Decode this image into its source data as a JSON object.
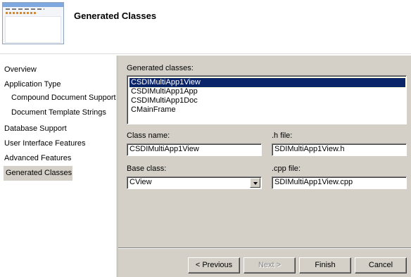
{
  "header": {
    "title": "Generated Classes"
  },
  "nav": {
    "items": [
      {
        "label": "Overview"
      },
      {
        "label": "Application Type"
      },
      {
        "label": "Compound Document Support"
      },
      {
        "label": "Document Template Strings"
      },
      {
        "label": "Database Support"
      },
      {
        "label": "User Interface Features"
      },
      {
        "label": "Advanced Features"
      },
      {
        "label": "Generated Classes",
        "selected": true
      }
    ]
  },
  "main": {
    "generated_classes_label": "Generated classes:",
    "classes": [
      {
        "name": "CSDIMultiApp1View",
        "selected": true
      },
      {
        "name": "CSDIMultiApp1App"
      },
      {
        "name": "CSDIMultiApp1Doc"
      },
      {
        "name": "CMainFrame"
      }
    ],
    "class_name_label": "Class name:",
    "class_name_value": "CSDIMultiApp1View",
    "h_file_label": ".h file:",
    "h_file_value": "SDIMultiApp1View.h",
    "base_class_label": "Base class:",
    "base_class_value": "CView",
    "cpp_file_label": ".cpp file:",
    "cpp_file_value": "SDIMultiApp1View.cpp"
  },
  "buttons": {
    "previous": "< Previous",
    "next": "Next >",
    "finish": "Finish",
    "cancel": "Cancel"
  }
}
